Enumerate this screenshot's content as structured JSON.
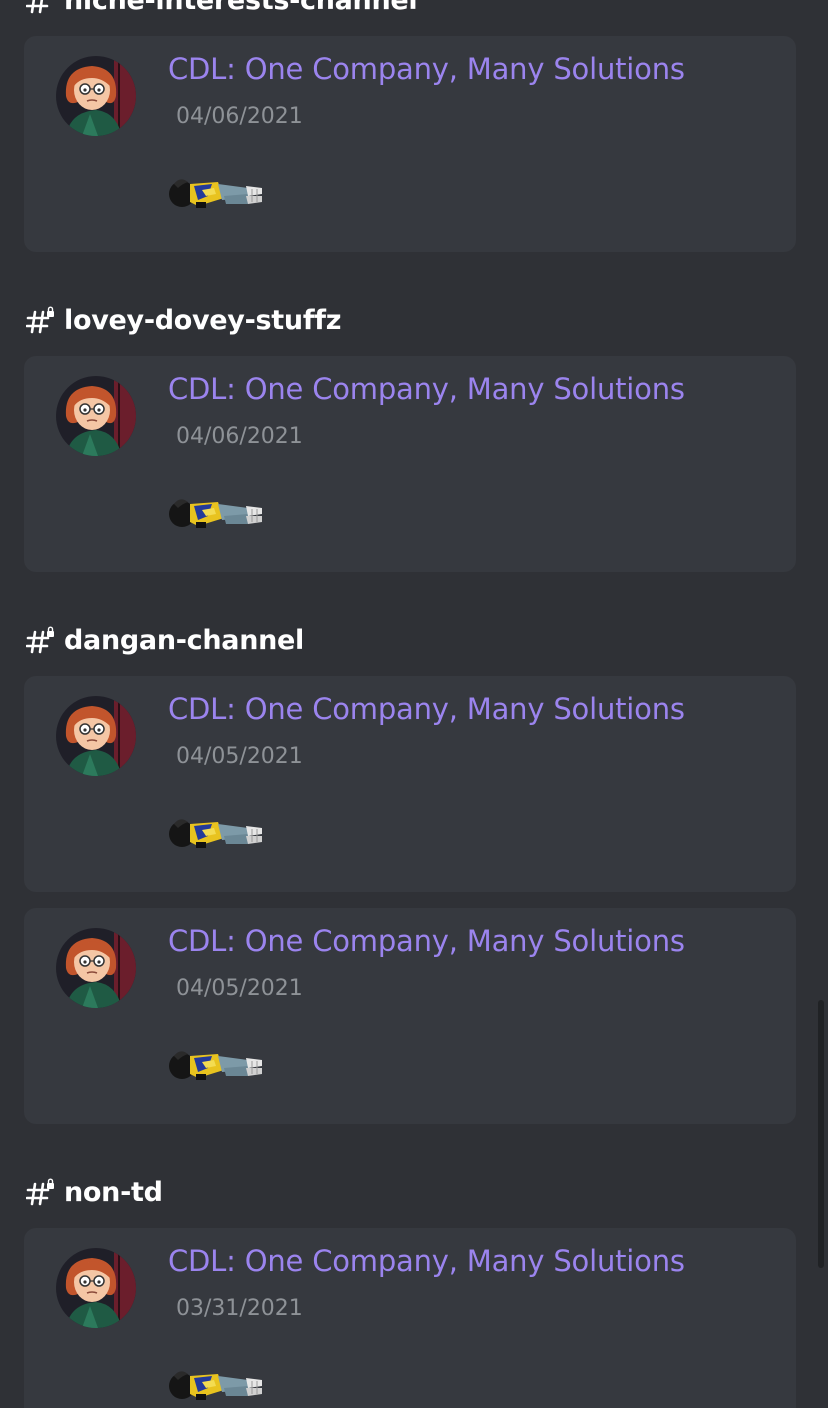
{
  "sections": [
    {
      "channel": "niche-interests-channel",
      "icon": "locked-channel-hash-icon"
    },
    {
      "channel": "lovey-dovey-stuffz",
      "icon": "locked-channel-hash-icon"
    },
    {
      "channel": "dangan-channel",
      "icon": "locked-channel-hash-icon"
    },
    {
      "channel": "non-td",
      "icon": "locked-channel-hash-icon"
    }
  ],
  "messages": [
    {
      "title": "CDL: One Company, Many Solutions",
      "date": "04/06/2021"
    },
    {
      "title": "CDL: One Company, Many Solutions",
      "date": "04/06/2021"
    },
    {
      "title": "CDL: One Company, Many Solutions",
      "date": "04/05/2021"
    },
    {
      "title": "CDL: One Company, Many Solutions",
      "date": "04/05/2021"
    },
    {
      "title": "CDL: One Company, Many Solutions",
      "date": "03/31/2021"
    }
  ],
  "colors": {
    "background": "#2f3136",
    "card": "#36393f",
    "title_link": "#9b84ee",
    "timestamp": "#8e9297",
    "header_text": "#ffffff"
  }
}
